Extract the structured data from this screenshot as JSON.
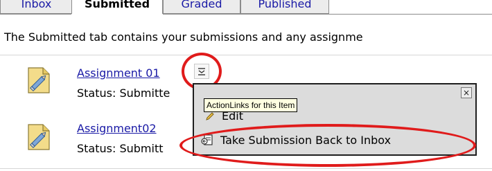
{
  "tabs": [
    {
      "label": "Inbox",
      "active": false
    },
    {
      "label": "Submitted",
      "active": true
    },
    {
      "label": "Graded",
      "active": false
    },
    {
      "label": "Published",
      "active": false
    }
  ],
  "intro": "The Submitted tab contains your submissions and any assignme",
  "items": [
    {
      "title": "Assignment 01",
      "status": "Status: Submitte"
    },
    {
      "title": "Assignment02",
      "status": "Status: Submitt"
    }
  ],
  "popup": {
    "close_glyph": "×",
    "tooltip": "ActionLinks for this Item",
    "edit_label": "Edit",
    "take_back_label": "Take Submission Back to Inbox"
  },
  "colors": {
    "annotation": "#e01b1b",
    "link": "#1a1aa6",
    "tooltip_bg": "#ffffe1"
  },
  "icons": {
    "document": "document-pen-icon",
    "actions": "action-links-icon",
    "take_back": "take-back-icon",
    "edit": "pencil-icon"
  }
}
